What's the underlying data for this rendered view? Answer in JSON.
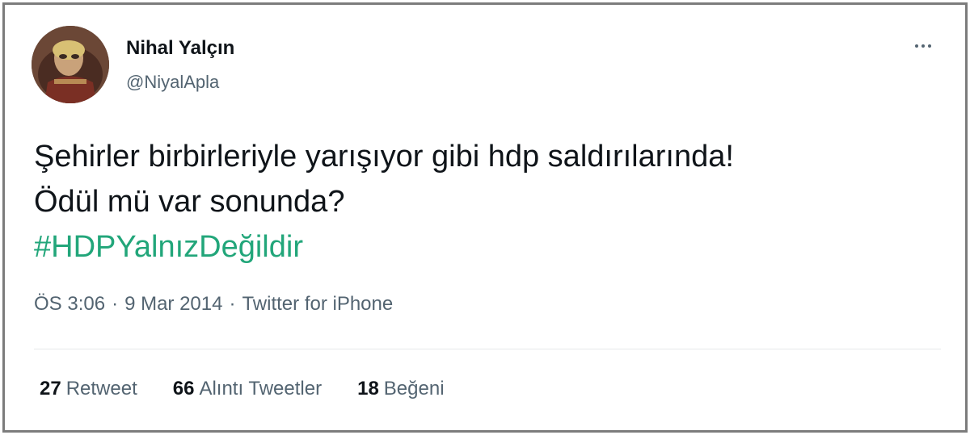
{
  "tweet": {
    "user": {
      "name": "Nihal Yalçın",
      "handle": "@NiyalApla",
      "avatar_icon": "profile-photo"
    },
    "text_lines": [
      "Şehirler birbirleriyle yarışıyor gibi hdp saldırılarında!",
      "Ödül mü var sonunda?"
    ],
    "hashtag": "#HDPYalnızDeğildir",
    "meta": {
      "time": "ÖS 3:06",
      "date": "9 Mar 2014",
      "separator": "·",
      "source": "Twitter for iPhone"
    },
    "stats": {
      "retweets": {
        "count": "27",
        "label": "Retweet"
      },
      "quotes": {
        "count": "66",
        "label": "Alıntı Tweetler"
      },
      "likes": {
        "count": "18",
        "label": "Beğeni"
      }
    },
    "more_icon": "more-horizontal-icon"
  },
  "colors": {
    "hashtag": "#22a67a",
    "text_primary": "#0f1419",
    "text_secondary": "#536471",
    "frame_border": "#7c7c7c"
  }
}
